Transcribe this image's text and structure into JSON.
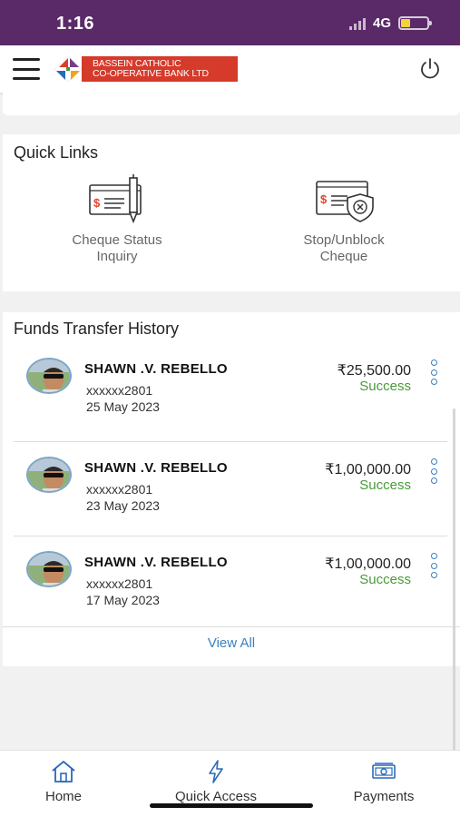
{
  "status_bar": {
    "time": "1:16",
    "network": "4G",
    "battery_level": 0.35,
    "background": "#5a2a68"
  },
  "header": {
    "menu_icon": "hamburger-icon",
    "bank_name_line1": "BASSEIN CATHOLIC",
    "bank_name_line2": "CO-OPERATIVE BANK LTD",
    "power_icon": "power-icon",
    "brand_color": "#d63a2a"
  },
  "quick_links": {
    "title": "Quick Links",
    "items": [
      {
        "icon": "cheque-pen-icon",
        "line1": "Cheque Status",
        "line2": "Inquiry"
      },
      {
        "icon": "cheque-block-icon",
        "line1": "Stop/Unblock",
        "line2": "Cheque"
      }
    ]
  },
  "history": {
    "title": "Funds Transfer History",
    "transactions": [
      {
        "name": "SHAWN .V. REBELLO",
        "account": "xxxxxx2801",
        "date": "25 May 2023",
        "amount": "₹25,500.00",
        "status": "Success"
      },
      {
        "name": "SHAWN .V. REBELLO",
        "account": "xxxxxx2801",
        "date": "23 May 2023",
        "amount": "₹1,00,000.00",
        "status": "Success"
      },
      {
        "name": "SHAWN .V. REBELLO",
        "account": "xxxxxx2801",
        "date": "17 May 2023",
        "amount": "₹1,00,000.00",
        "status": "Success"
      }
    ],
    "view_all": "View All",
    "status_color": "#4a9a3a",
    "link_color": "#3a7fc0"
  },
  "bottom_nav": {
    "items": [
      {
        "icon": "home-icon",
        "label": "Home"
      },
      {
        "icon": "lightning-icon",
        "label": "Quick Access"
      },
      {
        "icon": "cash-icon",
        "label": "Payments"
      }
    ]
  }
}
